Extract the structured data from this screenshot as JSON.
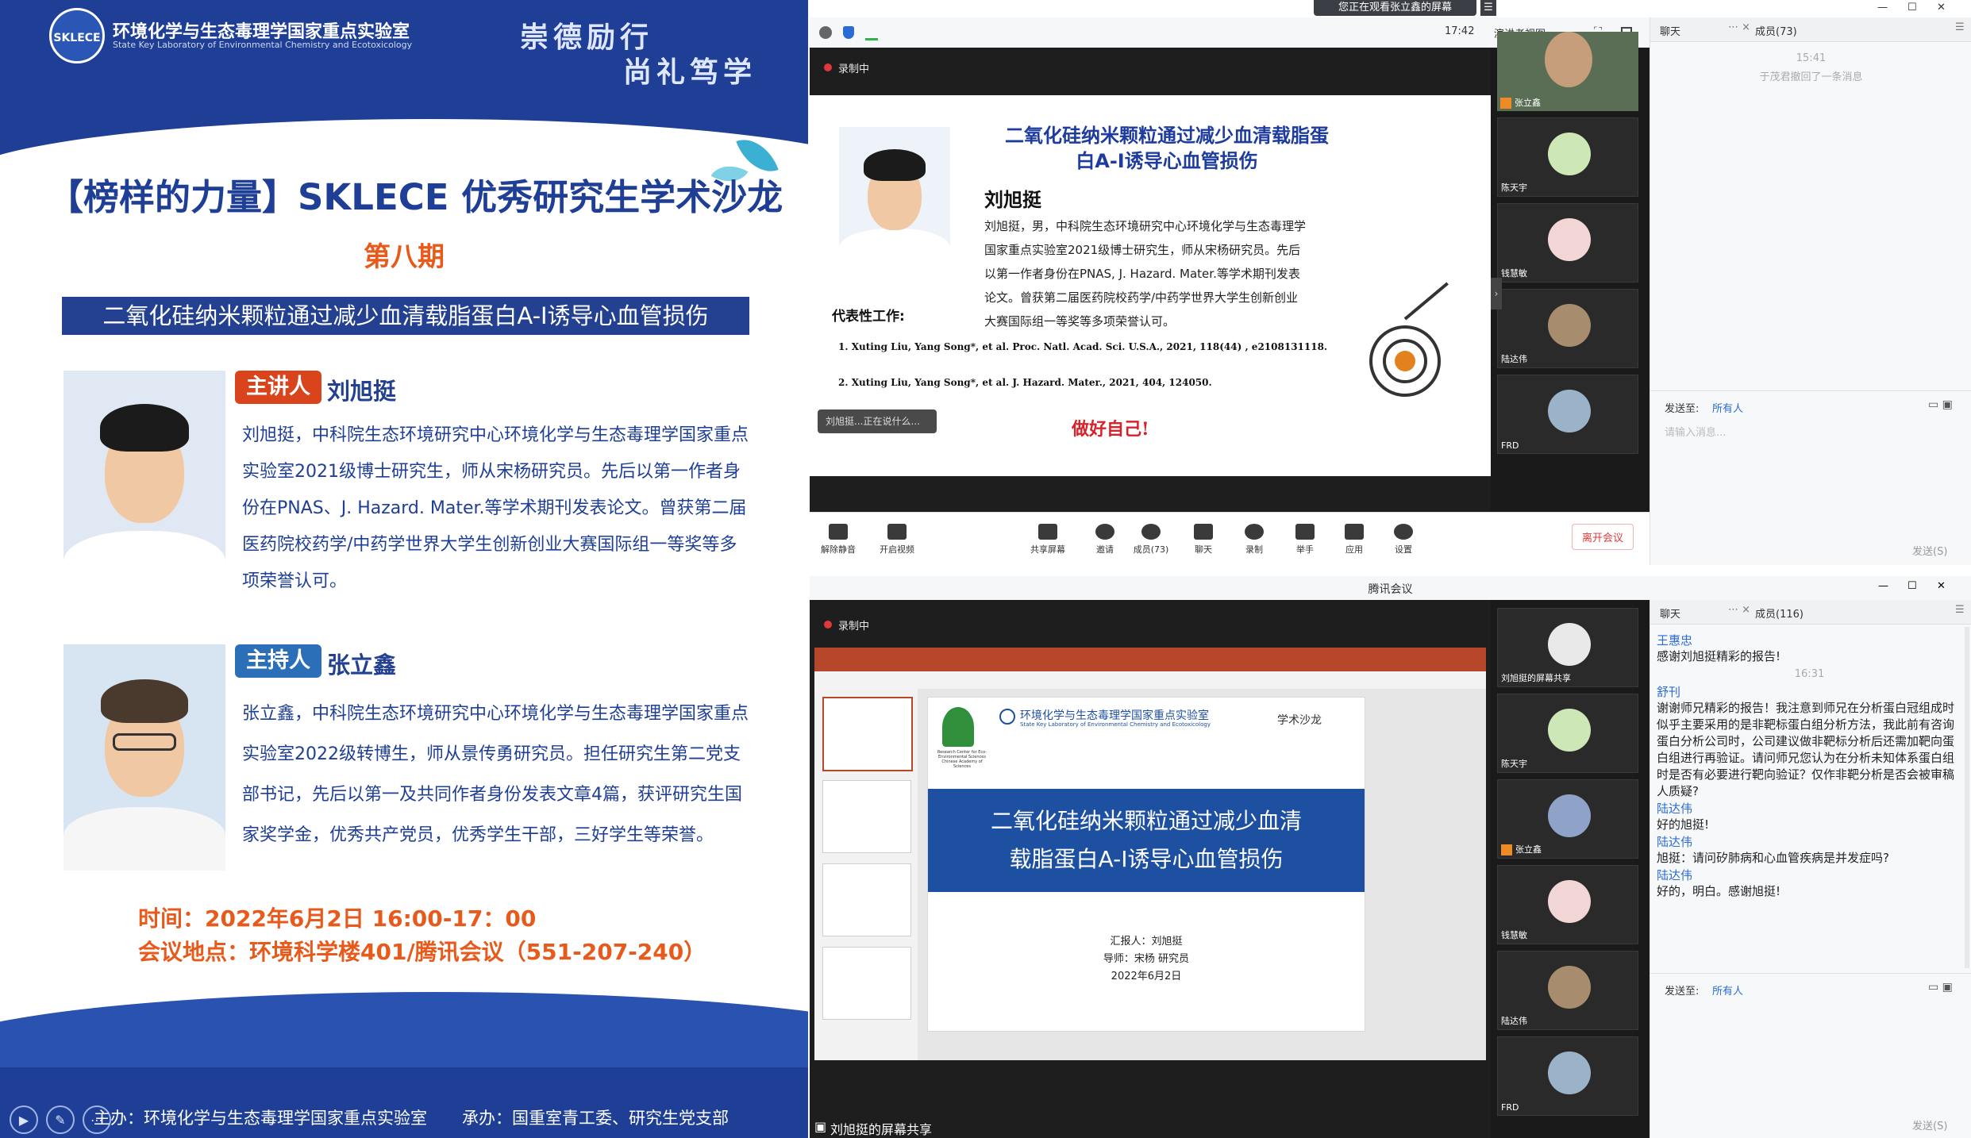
{
  "poster": {
    "lab_name_cn": "环境化学与生态毒理学国家重点实验室",
    "lab_name_en": "State Key Laboratory of Environmental Chemistry and Ecotoxicology",
    "logo_text": "SKLECE",
    "motto_line1": "崇德励行",
    "motto_line2": "尚礼笃学",
    "title": "【榜样的力量】SKLECE 优秀研究生学术沙龙",
    "issue": "第八期",
    "talk_title": "二氧化硅纳米颗粒通过减少血清载脂蛋白A-I诱导心血管损伤",
    "speaker": {
      "role": "主讲人",
      "name": "刘旭挺",
      "bio": "刘旭挺，中科院生态环境研究中心环境化学与生态毒理学国家重点实验室2021级博士研究生，师从宋杨研究员。先后以第一作者身份在PNAS、J. Hazard. Mater.等学术期刊发表论文。曾获第二届医药院校药学/中药学世界大学生创新创业大赛国际组一等奖等多项荣誉认可。"
    },
    "host": {
      "role": "主持人",
      "name": "张立鑫",
      "bio": "张立鑫，中科院生态环境研究中心环境化学与生态毒理学国家重点实验室2022级转博生，师从景传勇研究员。担任研究生第二党支部书记，先后以第一及共同作者身份发表文章4篇，获评研究生国家奖学金，优秀共产党员，优秀学生干部，三好学生等荣誉。"
    },
    "time": "时间：2022年6月2日 16:00-17：00",
    "location": "会议地点：环境科学楼401/腾讯会议（551-207-240）",
    "organizer": "主办：环境化学与生态毒理学国家重点实验室",
    "co_organizer": "承办：国重室青工委、研究生党支部"
  },
  "meeting1": {
    "viewing_banner": "您正在观看张立鑫的屏幕",
    "clock": "17:42",
    "view_mode": "演讲者视图",
    "chat_tab": "聊天",
    "members_tab": "成员(73)",
    "recording": "录制中",
    "chat_time": "15:41",
    "chat_recall": "于茂君撤回了一条消息",
    "send_to_label": "发送至:",
    "send_to_value": "所有人",
    "input_placeholder": "请输入消息...",
    "send_button": "发送(S)",
    "leave_button": "离开会议",
    "slide_overlay": "刘旭挺...正在说什么...",
    "slide": {
      "title": "二氧化硅纳米颗粒通过减少血清载脂蛋白A-I诱导心血管损伤",
      "name": "刘旭挺",
      "bio": "刘旭挺，男，中科院生态环境研究中心环境化学与生态毒理学国家重点实验室2021级博士研究生，师从宋杨研究员。先后以第一作者身份在PNAS, J. Hazard. Mater.等学术期刊发表论文。曾获第二届医药院校药学/中药学世界大学生创新创业大赛国际组一等奖等多项荣誉认可。",
      "works_heading": "代表性工作:",
      "ref1": "1. Xuting Liu, Yang Song*, et al. Proc. Natl. Acad. Sci. U.S.A., 2021, 118(44) , e2108131118.",
      "ref2": "2. Xuting Liu, Yang Song*, et al. J. Hazard. Mater., 2021, 404, 124050.",
      "slogan": "做好自己!"
    },
    "tiles": [
      {
        "label": "张立鑫"
      },
      {
        "label": "陈天宇"
      },
      {
        "label": "钱慧敏"
      },
      {
        "label": "陆达伟"
      },
      {
        "label": "FRD"
      }
    ],
    "toolbar_items": [
      {
        "label": "解除静音"
      },
      {
        "label": "开启视频"
      },
      {
        "label": "共享屏幕"
      },
      {
        "label": "邀请"
      },
      {
        "label": "成员(73)"
      },
      {
        "label": "聊天"
      },
      {
        "label": "录制"
      },
      {
        "label": "举手"
      },
      {
        "label": "应用"
      },
      {
        "label": "设置"
      }
    ]
  },
  "meeting2": {
    "window_title": "腾讯会议",
    "chat_tab": "聊天",
    "members_tab": "成员(116)",
    "recording": "录制中",
    "share_label": "刘旭挺的屏幕共享",
    "send_to_label": "发送至:",
    "send_to_value": "所有人",
    "send_button": "发送(S)",
    "chat_time": "16:31",
    "messages": [
      {
        "name": "王惠忠",
        "text": "感谢刘旭挺精彩的报告!"
      },
      {
        "name": "舒刊",
        "text": "谢谢师兄精彩的报告！我注意到师兄在分析蛋白冠组成时似乎主要采用的是非靶标蛋白组分析方法，我此前有咨询蛋白分析公司时，公司建议做非靶标分析后还需加靶向蛋白组进行再验证。请问师兄您认为在分析未知体系蛋白组时是否有必要进行靶向验证？仅作非靶分析是否会被审稿人质疑?"
      },
      {
        "name": "陆达伟",
        "text": "好的旭挺!"
      },
      {
        "name": "陆达伟",
        "text": "旭挺：请问矽肺病和心血管疾病是并发症吗?"
      },
      {
        "name": "陆达伟",
        "text": "好的，明白。感谢旭挺!"
      }
    ],
    "tiles": [
      {
        "label": "刘旭挺的屏幕共享"
      },
      {
        "label": "陈天宇"
      },
      {
        "label": "张立鑫"
      },
      {
        "label": "钱慧敏"
      },
      {
        "label": "陆达伟"
      },
      {
        "label": "FRD"
      }
    ],
    "slide": {
      "header_cn": "环境化学与生态毒理学国家重点实验室",
      "header_en": "State Key Laboratory of Environmental Chemistry and Ecotoxicology",
      "header_tag": "学术沙龙",
      "rcees": "Research Center for Eco-Environmental Sciences Chinese Academy of Sciences",
      "band_line1": "二氧化硅纳米颗粒通过减少血清",
      "band_line2": "载脂蛋白A-I诱导心血管损伤",
      "reporter": "汇报人：刘旭挺",
      "advisor": "导师：宋杨 研究员",
      "date": "2022年6月2日"
    }
  },
  "colors": {
    "poster_blue": "#1f3f97",
    "accent_orange": "#e85a1b",
    "speaker_badge": "#d9441c",
    "host_badge": "#2a6fb7",
    "chat_link": "#2b6bd6",
    "leave_red": "#e03b3b"
  }
}
